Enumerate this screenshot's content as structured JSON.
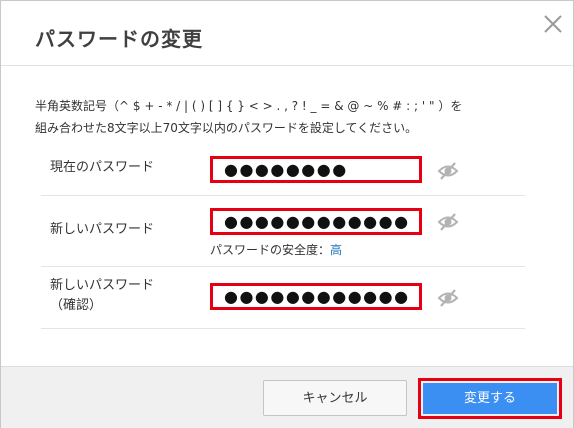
{
  "dialog": {
    "title": "パスワードの変更",
    "close_icon": "close-icon",
    "description_line1": "半角英数記号（^ $ + - * / | ( ) [ ] { } < > . , ? ! _ = & @ ~ % # : ; ' \" ）を",
    "description_line2": "組み合わせた8文字以上70文字以内のパスワードを設定してください。"
  },
  "fields": [
    {
      "label": "現在のパスワード",
      "masked_value": "●●●●●●●●",
      "visibility_icon": "eye-slash-icon"
    },
    {
      "label": "新しいパスワード",
      "masked_value": "●●●●●●●●●●●●",
      "visibility_icon": "eye-slash-icon",
      "strength_label": "パスワードの安全度：",
      "strength_value": "高"
    },
    {
      "label_line1": "新しいパスワード",
      "label_line2": "（確認）",
      "masked_value": "●●●●●●●●●●●●",
      "visibility_icon": "eye-slash-icon"
    }
  ],
  "footer": {
    "cancel_label": "キャンセル",
    "submit_label": "変更する"
  },
  "colors": {
    "highlight_border": "#e60012",
    "primary_button": "#3b8ff2",
    "strength_high": "#1a76b8"
  }
}
